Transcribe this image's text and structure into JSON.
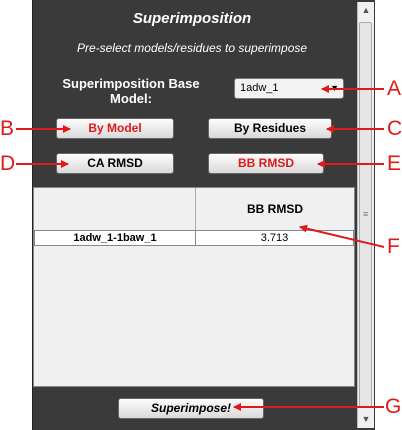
{
  "panel": {
    "title": "Superimposition",
    "subtitle": "Pre-select models/residues to superimpose",
    "base_model_label": "Superimposition Base Model:",
    "base_model_value": "1adw_1"
  },
  "buttons": {
    "by_model": "By Model",
    "by_residues": "By Residues",
    "ca_rmsd": "CA RMSD",
    "bb_rmsd": "BB RMSD",
    "superimpose": "Superimpose!"
  },
  "table": {
    "column_header": "BB RMSD",
    "rows": [
      {
        "label": "1adw_1-1baw_1",
        "value": "3.713"
      }
    ]
  },
  "callouts": {
    "a": "A",
    "b": "B",
    "c": "C",
    "d": "D",
    "e": "E",
    "f": "F",
    "g": "G"
  },
  "colors": {
    "panel": "#3a3a3a",
    "accent_red": "#e01919",
    "button_face": "#ececec"
  }
}
